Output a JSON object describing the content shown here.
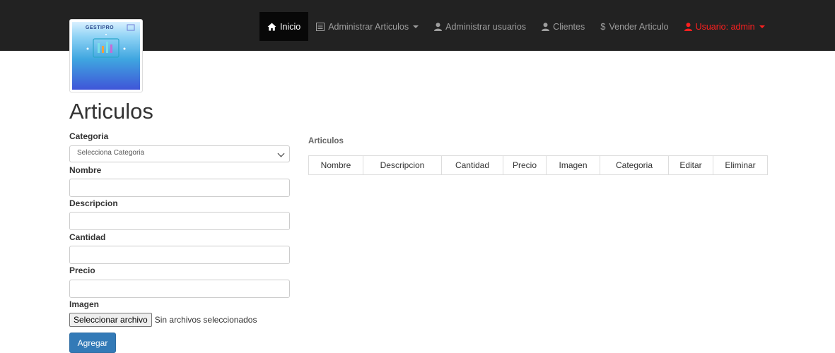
{
  "nav": {
    "items": [
      {
        "label": "Inicio",
        "icon": "home-icon",
        "active": true
      },
      {
        "label": "Administrar Articulos",
        "icon": "list-icon",
        "dropdown": true
      },
      {
        "label": "Administrar usuarios",
        "icon": "user-icon"
      },
      {
        "label": "Clientes",
        "icon": "user-icon"
      },
      {
        "label": "Vender Articulo",
        "icon": "dollar-icon"
      },
      {
        "label": "Usuario: admin",
        "icon": "user-icon",
        "dropdown": true
      }
    ],
    "user_color": "#ff1f1f"
  },
  "logo": {
    "text": "GESTIPRO"
  },
  "page": {
    "title": "Articulos"
  },
  "form": {
    "categoria_label": "Categoria",
    "categoria_selected": "Selecciona Categoria",
    "nombre_label": "Nombre",
    "nombre_value": "",
    "descripcion_label": "Descripcion",
    "descripcion_value": "",
    "cantidad_label": "Cantidad",
    "cantidad_value": "",
    "precio_label": "Precio",
    "precio_value": "",
    "imagen_label": "Imagen",
    "file_button": "Seleccionar archivo",
    "file_status": "Sin archivos seleccionados",
    "submit_label": "Agregar"
  },
  "table": {
    "caption": "Articulos",
    "columns": [
      "Nombre",
      "Descripcion",
      "Cantidad",
      "Precio",
      "Imagen",
      "Categoria",
      "Editar",
      "Eliminar"
    ],
    "rows": []
  },
  "colors": {
    "navbar": "#222222",
    "primary": "#337ab7",
    "accent_user": "#ff1f1f"
  }
}
